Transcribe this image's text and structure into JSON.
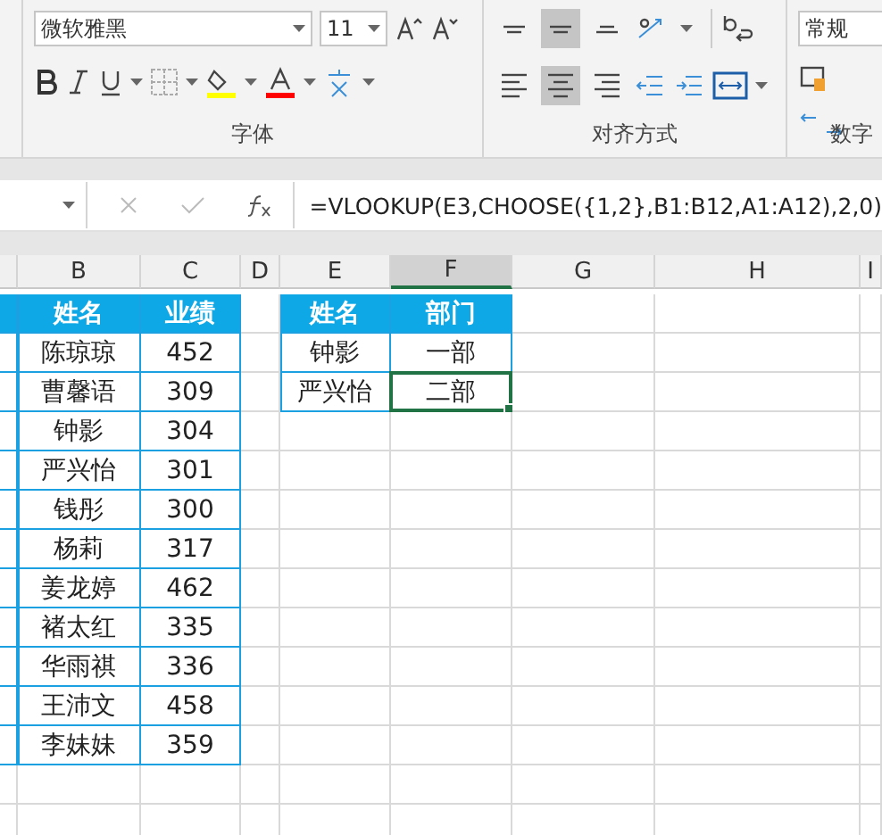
{
  "ribbon": {
    "font_name": "微软雅黑",
    "font_size": "11",
    "align_buttons": [
      {
        "kind": "top",
        "selected": false
      },
      {
        "kind": "middle",
        "selected": true
      },
      {
        "kind": "bottom",
        "selected": false
      },
      {
        "kind": "left",
        "selected": false
      },
      {
        "kind": "center",
        "selected": true
      },
      {
        "kind": "right",
        "selected": false
      }
    ],
    "number_format": "常规",
    "groups": [
      {
        "label": "字体"
      },
      {
        "label": "对齐方式"
      },
      {
        "label": "数字"
      }
    ]
  },
  "formula_bar": {
    "formula": "=VLOOKUP(E3,CHOOSE({1,2},B1:B12,A1:A12),2,0)"
  },
  "columns": [
    "B",
    "C",
    "D",
    "E",
    "F",
    "G",
    "H",
    "I"
  ],
  "tables": [
    {
      "rows": [
        [
          {
            "text": "姓名",
            "selected": false
          },
          {
            "text": "业绩",
            "selected": false
          }
        ],
        [
          {
            "text": "陈琼琼",
            "selected": false
          },
          {
            "text": "452",
            "selected": false
          }
        ],
        [
          {
            "text": "曹馨语",
            "selected": false
          },
          {
            "text": "309",
            "selected": false
          }
        ],
        [
          {
            "text": "钟影",
            "selected": false
          },
          {
            "text": "304",
            "selected": false
          }
        ],
        [
          {
            "text": "严兴怡",
            "selected": false
          },
          {
            "text": "301",
            "selected": false
          }
        ],
        [
          {
            "text": "钱彤",
            "selected": false
          },
          {
            "text": "300",
            "selected": false
          }
        ],
        [
          {
            "text": "杨莉",
            "selected": false
          },
          {
            "text": "317",
            "selected": false
          }
        ],
        [
          {
            "text": "姜龙婷",
            "selected": false
          },
          {
            "text": "462",
            "selected": false
          }
        ],
        [
          {
            "text": "褚太红",
            "selected": false
          },
          {
            "text": "335",
            "selected": false
          }
        ],
        [
          {
            "text": "华雨祺",
            "selected": false
          },
          {
            "text": "336",
            "selected": false
          }
        ],
        [
          {
            "text": "王沛文",
            "selected": false
          },
          {
            "text": "458",
            "selected": false
          }
        ],
        [
          {
            "text": "李妹妹",
            "selected": false
          },
          {
            "text": "359",
            "selected": false
          }
        ]
      ]
    },
    {
      "rows": [
        [
          {
            "text": "姓名",
            "selected": false
          },
          {
            "text": "部门",
            "selected": false
          }
        ],
        [
          {
            "text": "钟影",
            "selected": false
          },
          {
            "text": "一部",
            "selected": false
          }
        ],
        [
          {
            "text": "严兴怡",
            "selected": false
          },
          {
            "text": "二部",
            "selected": true
          }
        ]
      ]
    }
  ]
}
